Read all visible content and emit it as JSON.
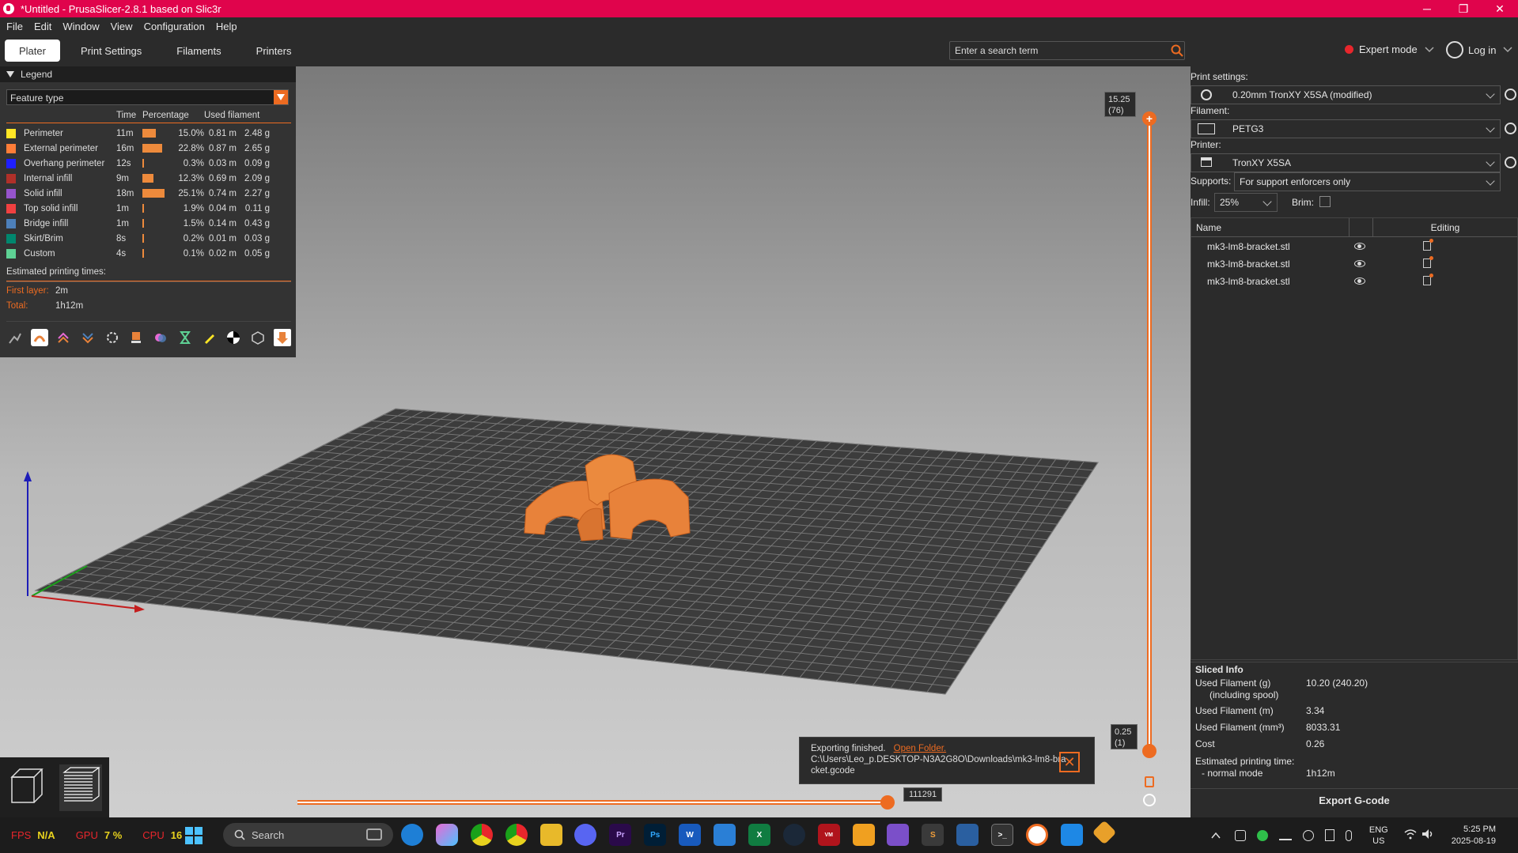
{
  "window": {
    "title": "*Untitled - PrusaSlicer-2.8.1 based on Slic3r",
    "minimize": "─",
    "restore": "❐",
    "close": "✕"
  },
  "menu": [
    "File",
    "Edit",
    "Window",
    "View",
    "Configuration",
    "Help"
  ],
  "tabs": [
    "Plater",
    "Print Settings",
    "Filaments",
    "Printers"
  ],
  "active_tab": 0,
  "search": {
    "placeholder": "Enter a search term"
  },
  "mode": {
    "label": "Expert mode",
    "color": "#e8262c"
  },
  "login": {
    "label": "Log in"
  },
  "legend": {
    "title": "Legend",
    "view_type": "Feature type",
    "columns": {
      "time": "Time",
      "percentage": "Percentage",
      "filament": "Used filament"
    },
    "rows": [
      {
        "name": "Perimeter",
        "color": "#ffe625",
        "time": "11m",
        "pct": "15.0%",
        "pct_value": 15.0,
        "meters": "0.81 m",
        "grams": "2.48 g"
      },
      {
        "name": "External perimeter",
        "color": "#ff7d38",
        "time": "16m",
        "pct": "22.8%",
        "pct_value": 22.8,
        "meters": "0.87 m",
        "grams": "2.65 g"
      },
      {
        "name": "Overhang perimeter",
        "color": "#1f1fff",
        "time": "12s",
        "pct": "0.3%",
        "pct_value": 0.3,
        "meters": "0.03 m",
        "grams": "0.09 g"
      },
      {
        "name": "Internal infill",
        "color": "#b03029",
        "time": "9m",
        "pct": "12.3%",
        "pct_value": 12.3,
        "meters": "0.69 m",
        "grams": "2.09 g"
      },
      {
        "name": "Solid infill",
        "color": "#9654cc",
        "time": "18m",
        "pct": "25.1%",
        "pct_value": 25.1,
        "meters": "0.74 m",
        "grams": "2.27 g"
      },
      {
        "name": "Top solid infill",
        "color": "#f04040",
        "time": "1m",
        "pct": "1.9%",
        "pct_value": 1.9,
        "meters": "0.04 m",
        "grams": "0.11 g"
      },
      {
        "name": "Bridge infill",
        "color": "#4d80ba",
        "time": "1m",
        "pct": "1.5%",
        "pct_value": 1.5,
        "meters": "0.14 m",
        "grams": "0.43 g"
      },
      {
        "name": "Skirt/Brim",
        "color": "#00876e",
        "time": "8s",
        "pct": "0.2%",
        "pct_value": 0.2,
        "meters": "0.01 m",
        "grams": "0.03 g"
      },
      {
        "name": "Custom",
        "color": "#5ed194",
        "time": "4s",
        "pct": "0.1%",
        "pct_value": 0.1,
        "meters": "0.02 m",
        "grams": "0.05 g"
      }
    ],
    "estimated_label": "Estimated printing times:",
    "first_layer_label": "First layer:",
    "first_layer_value": "2m",
    "total_label": "Total:",
    "total_value": "1h12m"
  },
  "vslider": {
    "top_value": "15.25",
    "top_layer": "(76)",
    "bottom_value": "0.25",
    "bottom_layer": "(1)"
  },
  "hslider": {
    "value": "111291",
    "position_fraction": 1.0
  },
  "toast": {
    "title": "Exporting finished.",
    "link": "Open Folder.",
    "path1": "C:\\Users\\Leo_p.DESKTOP-N3A2G8O\\Downloads\\mk3-lm8-bra",
    "path2": "cket.gcode"
  },
  "right": {
    "print_settings_label": "Print settings:",
    "print_settings_value": "0.20mm TronXY X5SA (modified)",
    "filament_label": "Filament:",
    "filament_value": "PETG3",
    "printer_label": "Printer:",
    "printer_value": "TronXY X5SA",
    "supports_label": "Supports:",
    "supports_value": "For support enforcers only",
    "infill_label": "Infill:",
    "infill_value": "25%",
    "brim_label": "Brim:",
    "table_name": "Name",
    "table_editing": "Editing",
    "objects": [
      "mk3-lm8-bracket.stl",
      "mk3-lm8-bracket.stl",
      "mk3-lm8-bracket.stl"
    ]
  },
  "sliced": {
    "title": "Sliced Info",
    "filament_g_label": "Used Filament (g)",
    "filament_g_sub": "(including spool)",
    "filament_g_value": "10.20 (240.20)",
    "filament_m_label": "Used Filament (m)",
    "filament_m_value": "3.34",
    "filament_mm3_label": "Used Filament (mm³)",
    "filament_mm3_value": "8033.31",
    "cost_label": "Cost",
    "cost_value": "0.26",
    "est_label": "Estimated printing time:",
    "normal_label": "- normal mode",
    "normal_value": "1h12m",
    "export_button": "Export G-code"
  },
  "taskbar": {
    "fps_label": "FPS",
    "fps_value": "N/A",
    "gpu_label": "GPU",
    "gpu_value": "7 %",
    "cpu_label": "CPU",
    "cpu_value": "16",
    "search_label": "Search",
    "lang1": "ENG",
    "lang2": "US",
    "time": "5:25 PM",
    "date": "2025-08-19"
  }
}
